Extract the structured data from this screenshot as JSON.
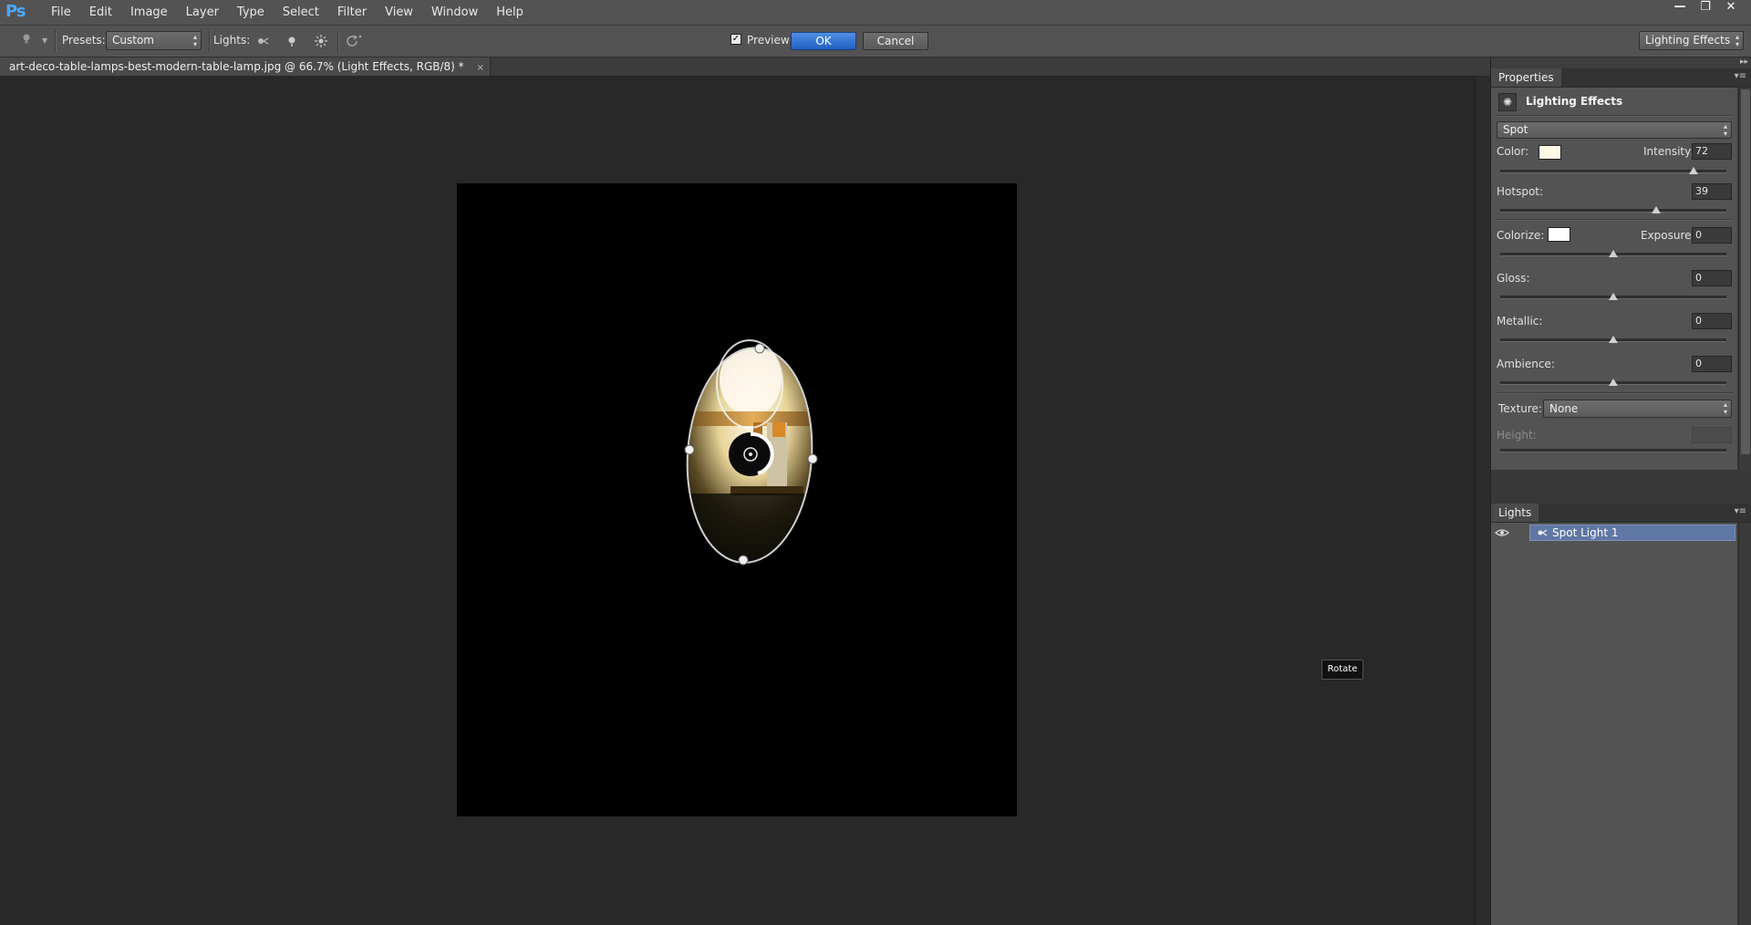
{
  "app": {
    "logo": "Ps"
  },
  "menu": [
    "File",
    "Edit",
    "Image",
    "Layer",
    "Type",
    "Select",
    "Filter",
    "View",
    "Window",
    "Help"
  ],
  "window_controls": {
    "minimize": "—",
    "restore": "❐",
    "close": "✕"
  },
  "options_bar": {
    "presets_label": "Presets:",
    "presets_value": "Custom",
    "lights_label": "Lights:",
    "preview_label": "Preview",
    "preview_checked": true,
    "ok_label": "OK",
    "cancel_label": "Cancel",
    "workspace_value": "Lighting Effects"
  },
  "document": {
    "tab_title": "art-deco-table-lamps-best-modern-table-lamp.jpg @ 66.7% (Light Effects, RGB/8) *",
    "close_glyph": "×"
  },
  "canvas": {
    "tooltip": "Rotate"
  },
  "properties_panel": {
    "title": "Properties",
    "header": "Lighting Effects",
    "light_type": "Spot",
    "color_label": "Color:",
    "color": "#fff8e6",
    "intensity_label": "Intensity:",
    "intensity": "72",
    "hotspot_label": "Hotspot:",
    "hotspot": "39",
    "colorize_label": "Colorize:",
    "colorize_color": "#ffffff",
    "exposure_label": "Exposure:",
    "exposure": "0",
    "gloss_label": "Gloss:",
    "gloss": "0",
    "metallic_label": "Metallic:",
    "metallic": "0",
    "ambience_label": "Ambience:",
    "ambience": "0",
    "texture_label": "Texture:",
    "texture": "None",
    "height_label": "Height:"
  },
  "lights_panel": {
    "title": "Lights",
    "items": [
      {
        "name": "Spot Light 1",
        "visible": true,
        "selected": true
      }
    ]
  },
  "colors": {
    "accent": "#2e6fd0",
    "selection": "#5f77a4"
  }
}
